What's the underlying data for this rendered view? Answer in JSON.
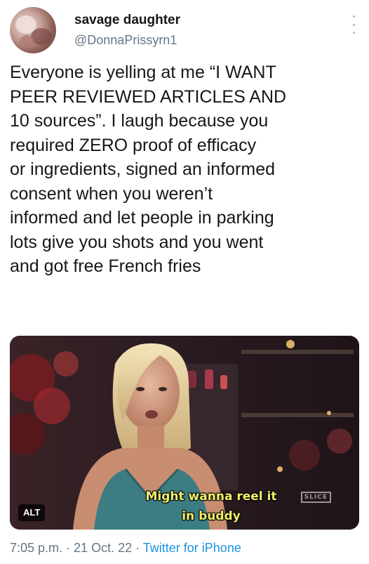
{
  "author": {
    "display_name": "savage daughter",
    "handle": "@DonnaPrissyrn1"
  },
  "tweet": {
    "lines": [
      "Everyone is yelling at me “I WANT",
      "PEER REVIEWED ARTICLES AND",
      "10 sources”.  I laugh because you",
      "required ZERO proof of efficacy",
      "or ingredients, signed an informed",
      "consent when you weren’t",
      "informed and let people in parking",
      "lots give you shots and you went",
      "and got free French fries"
    ]
  },
  "media": {
    "caption_line1": "Might wanna reel it",
    "caption_line2": "in buddy",
    "alt_label": "ALT",
    "watermark": "SLICE"
  },
  "meta": {
    "time": "7:05 p.m.",
    "separator1": " · ",
    "date": "21 Oct. 22",
    "separator2": " · ",
    "source": "Twitter for iPhone"
  },
  "icons": {
    "more": "more-options-icon"
  },
  "colors": {
    "text": "#14171a",
    "secondary": "#657786",
    "link": "#1b95e0",
    "caption": "#f2ee6b"
  }
}
